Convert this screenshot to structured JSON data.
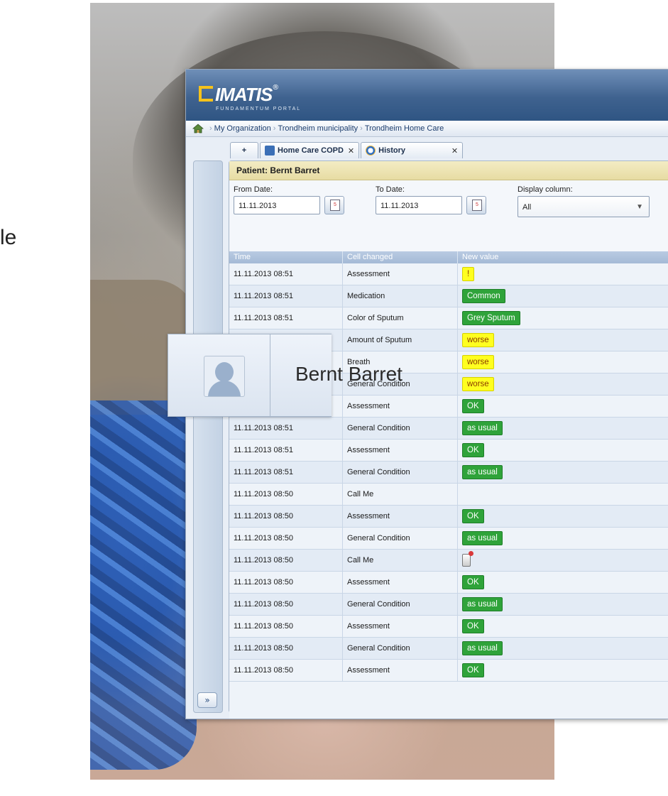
{
  "side_text": "le",
  "app": {
    "logo": "IMATIS",
    "logo_reg": "®",
    "logo_sub": "FUNDAMENTUM PORTAL",
    "breadcrumb": [
      "My Organization",
      "Trondheim municipality",
      "Trondheim Home Care"
    ],
    "tabs": [
      {
        "label": "+",
        "icon": "plus-icon"
      },
      {
        "label": "Home Care COPD",
        "icon": "person-icon"
      },
      {
        "label": "History",
        "icon": "history-icon"
      }
    ],
    "patient_title": "Patient: Bernt Barret",
    "filters": {
      "from_label": "From Date:",
      "from_value": "11.11.2013",
      "to_label": "To Date:",
      "to_value": "11.11.2013",
      "display_label": "Display column:",
      "display_value": "All"
    },
    "table": {
      "headers": [
        "Time",
        "Cell changed",
        "New value"
      ],
      "rows": [
        {
          "time": "11.11.2013 08:51",
          "cell": "Assessment",
          "value": "!",
          "style": "yellow"
        },
        {
          "time": "11.11.2013 08:51",
          "cell": "Medication",
          "value": "Common",
          "style": "green"
        },
        {
          "time": "11.11.2013 08:51",
          "cell": "Color of Sputum",
          "value": "Grey Sputum",
          "style": "green"
        },
        {
          "time": "",
          "cell": "Amount of Sputum",
          "value": "worse",
          "style": "yellow"
        },
        {
          "time": "",
          "cell": "Breath",
          "value": "worse",
          "style": "yellow"
        },
        {
          "time": "",
          "cell": "General Condition",
          "value": "worse",
          "style": "yellow"
        },
        {
          "time": "",
          "cell": "Assessment",
          "value": "OK",
          "style": "green"
        },
        {
          "time": "11.11.2013 08:51",
          "cell": "General Condition",
          "value": "as usual",
          "style": "green"
        },
        {
          "time": "11.11.2013 08:51",
          "cell": "Assessment",
          "value": "OK",
          "style": "green"
        },
        {
          "time": "11.11.2013 08:51",
          "cell": "General Condition",
          "value": "as usual",
          "style": "green"
        },
        {
          "time": "11.11.2013 08:50",
          "cell": "Call Me",
          "value": "",
          "style": "none"
        },
        {
          "time": "11.11.2013 08:50",
          "cell": "Assessment",
          "value": "OK",
          "style": "green"
        },
        {
          "time": "11.11.2013 08:50",
          "cell": "General Condition",
          "value": "as usual",
          "style": "green"
        },
        {
          "time": "11.11.2013 08:50",
          "cell": "Call Me",
          "value": "",
          "style": "phone"
        },
        {
          "time": "11.11.2013 08:50",
          "cell": "Assessment",
          "value": "OK",
          "style": "green"
        },
        {
          "time": "11.11.2013 08:50",
          "cell": "General Condition",
          "value": "as usual",
          "style": "green"
        },
        {
          "time": "11.11.2013 08:50",
          "cell": "Assessment",
          "value": "OK",
          "style": "green"
        },
        {
          "time": "11.11.2013 08:50",
          "cell": "General Condition",
          "value": "as usual",
          "style": "green"
        },
        {
          "time": "11.11.2013 08:50",
          "cell": "Assessment",
          "value": "OK",
          "style": "green"
        }
      ]
    },
    "expand_button": "»"
  },
  "callout": {
    "name": "Bernt Barret"
  },
  "colors": {
    "header_blue": "#3f628f",
    "badge_green": "#2fa33a",
    "badge_yellow": "#ffff1f",
    "patient_bar": "#e7dca3"
  }
}
